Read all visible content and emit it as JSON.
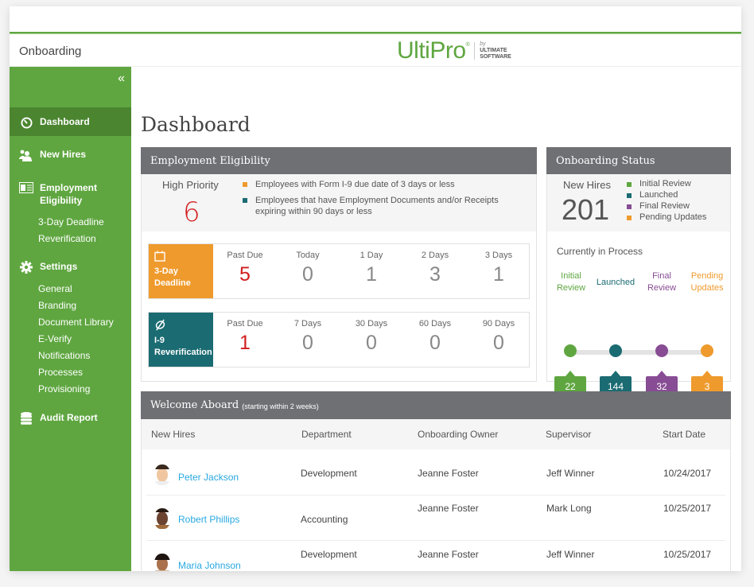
{
  "app": {
    "title": "Onboarding",
    "logo": {
      "name": "UltiPro",
      "by": "by",
      "company_line1": "ULTIMATE",
      "company_line2": "SOFTWARE"
    }
  },
  "sidebar": {
    "collapse_icon": "«",
    "items": [
      {
        "label": "Dashboard",
        "icon": "clock-icon",
        "active": true
      },
      {
        "label": "New Hires",
        "icon": "users-icon"
      },
      {
        "label": "Employment",
        "label2": "Eligibility",
        "icon": "id-card-icon",
        "children": [
          "3-Day Deadline",
          "Reverification"
        ]
      },
      {
        "label": "Settings",
        "icon": "gear-icon",
        "children": [
          "General",
          "Branding",
          "Document Library",
          "E-Verify",
          "Notifications",
          "Processes",
          "Provisioning"
        ]
      },
      {
        "label": "Audit Report",
        "icon": "database-icon"
      }
    ]
  },
  "page": {
    "title": "Dashboard"
  },
  "employment_eligibility": {
    "title": "Employment Eligibility",
    "high_priority_label": "High Priority",
    "high_priority_value": "6",
    "legend": [
      {
        "text": "Employees with Form I-9 due date of 3 days or less",
        "color": "#ef9a2c"
      },
      {
        "text": "Employees that have Employment Documents and/or Receipts expiring within 90 days or less",
        "color": "#1b6b72"
      }
    ],
    "deadline": {
      "label1": "3-Day",
      "label2": "Deadline",
      "icon": "calendar-icon",
      "color": "#ef9a2c",
      "columns": [
        {
          "label": "Past Due",
          "value": "5",
          "alert": true
        },
        {
          "label": "Today",
          "value": "0"
        },
        {
          "label": "1 Day",
          "value": "1"
        },
        {
          "label": "2 Days",
          "value": "3"
        },
        {
          "label": "3 Days",
          "value": "1"
        }
      ]
    },
    "reverification": {
      "label1": "I-9",
      "label2": "Reverification",
      "icon": "refresh-icon",
      "color": "#1b6b72",
      "columns": [
        {
          "label": "Past Due",
          "value": "1",
          "alert": true
        },
        {
          "label": "7 Days",
          "value": "0"
        },
        {
          "label": "30 Days",
          "value": "0"
        },
        {
          "label": "60 Days",
          "value": "0"
        },
        {
          "label": "90 Days",
          "value": "0"
        }
      ]
    }
  },
  "onboarding_status": {
    "title": "Onboarding Status",
    "new_hires_label": "New Hires",
    "new_hires_value": "201",
    "currently_label": "Currently in Process",
    "stages": [
      {
        "label1": "Initial",
        "label2": "Review",
        "legend": "Initial Review",
        "count": "22",
        "color": "#5fa640"
      },
      {
        "label1": "Launched",
        "label2": "",
        "legend": "Launched",
        "count": "144",
        "color": "#1b6b72"
      },
      {
        "label1": "Final",
        "label2": "Review",
        "legend": "Final Review",
        "count": "32",
        "color": "#874c93"
      },
      {
        "label1": "Pending",
        "label2": "Updates",
        "legend": "Pending Updates",
        "count": "3",
        "color": "#ef9a2c"
      }
    ]
  },
  "welcome_aboard": {
    "title": "Welcome Aboard",
    "subtitle": "(starting within 2 weeks)",
    "columns": [
      "New Hires",
      "Department",
      "Onboarding Owner",
      "Supervisor",
      "Start Date"
    ],
    "rows": [
      {
        "name": "Peter Jackson",
        "department": "Development",
        "owner": "Jeanne Foster",
        "supervisor": "Jeff Winner",
        "start_date": "10/24/2017"
      },
      {
        "name": "Robert Phillips",
        "department": "Accounting",
        "owner": "Jeanne Foster",
        "supervisor": "Mark Long",
        "start_date": "10/25/2017"
      },
      {
        "name": "Maria Johnson",
        "department": "Development",
        "owner": "Jeanne Foster",
        "supervisor": "Jeff Winner",
        "start_date": "10/25/2017"
      }
    ]
  }
}
